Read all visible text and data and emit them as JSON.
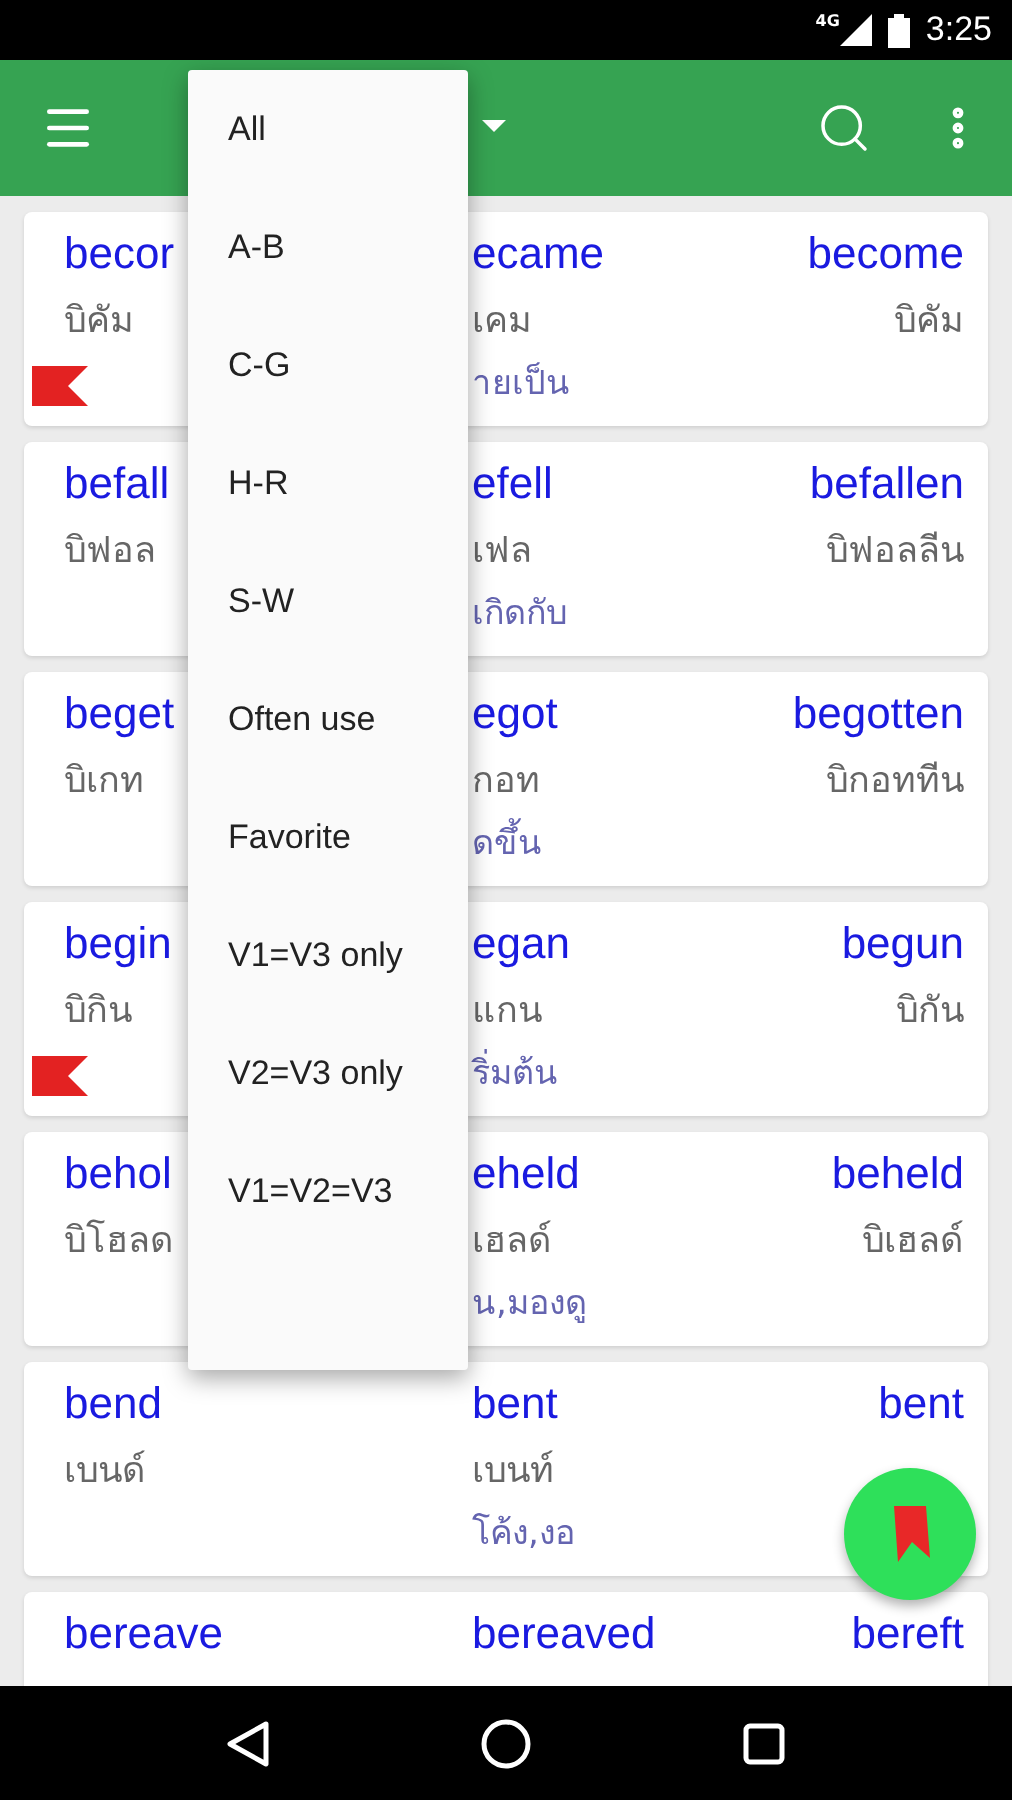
{
  "status_bar": {
    "network": "4G",
    "time": "3:25"
  },
  "menu": {
    "items": [
      {
        "label": "All"
      },
      {
        "label": "A-B"
      },
      {
        "label": "C-G"
      },
      {
        "label": "H-R"
      },
      {
        "label": "S-W"
      },
      {
        "label": "Often use"
      },
      {
        "label": "Favorite"
      },
      {
        "label": "V1=V3 only"
      },
      {
        "label": "V2=V3 only"
      },
      {
        "label": "V1=V2=V3"
      }
    ]
  },
  "verbs": [
    {
      "v1": "becor",
      "v1_thai": "บิคัม",
      "v2": "ecame",
      "v2_thai": "เคม",
      "v3": "become",
      "v3_thai": "บิคัม",
      "meaning": "ายเป็น",
      "favorite": true
    },
    {
      "v1": "befall",
      "v1_thai": "บิฟอล",
      "v2": "efell",
      "v2_thai": "เฟล",
      "v3": "befallen",
      "v3_thai": "บิฟอลลีน",
      "meaning": "เกิดกับ",
      "favorite": false
    },
    {
      "v1": "beget",
      "v1_thai": "บิเกท",
      "v2": "egot",
      "v2_thai": "กอท",
      "v3": "begotten",
      "v3_thai": "บิกอททีน",
      "meaning": "ดขึ้น",
      "favorite": false
    },
    {
      "v1": "begin",
      "v1_thai": "บิกิน",
      "v2": "egan",
      "v2_thai": "แกน",
      "v3": "begun",
      "v3_thai": "บิกัน",
      "meaning": "ริ่มต้น",
      "favorite": true
    },
    {
      "v1": "behol",
      "v1_thai": "บิโฮลด",
      "v2": "eheld",
      "v2_thai": "เฮลด์",
      "v3": "beheld",
      "v3_thai": "บิเฮลด์",
      "meaning": "น,มองดู",
      "favorite": false
    },
    {
      "v1": "bend",
      "v1_thai": "เบนด์",
      "v2": "bent",
      "v2_thai": "เบนท์",
      "v3": "bent",
      "meaning": "โค้ง,งอ",
      "favorite": false
    },
    {
      "v1": "bereave",
      "v2": "bereaved",
      "v3": "bereft",
      "favorite": false
    }
  ]
}
